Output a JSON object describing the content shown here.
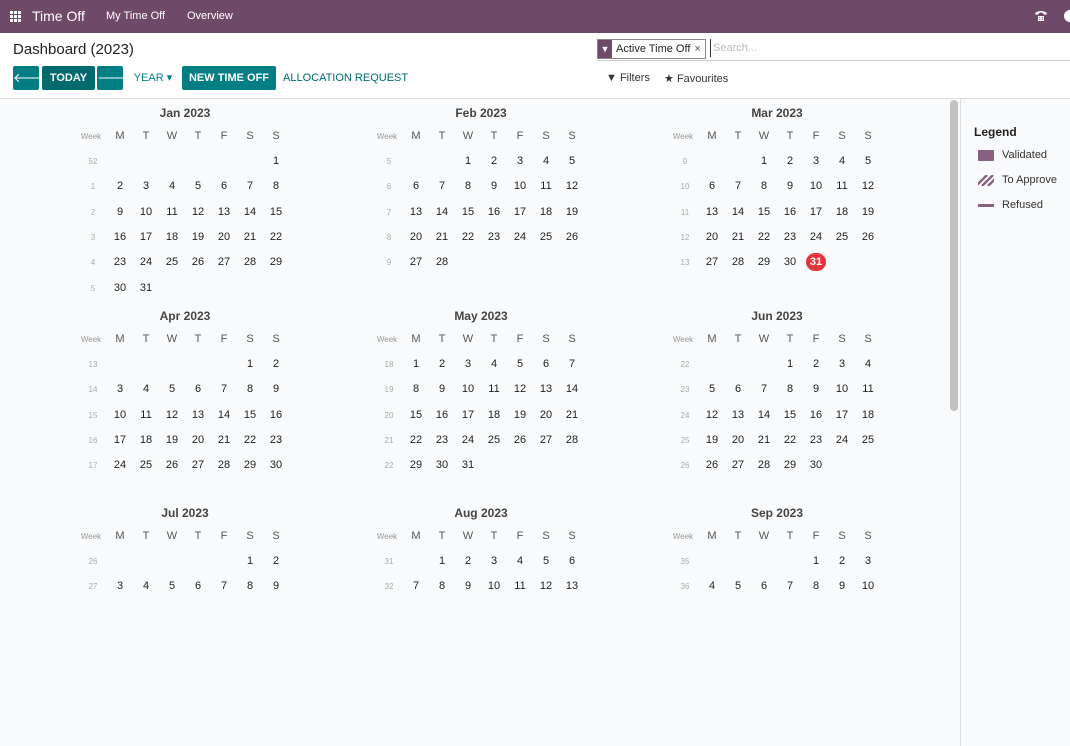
{
  "topbar": {
    "app_name": "Time Off",
    "nav": [
      "My Time Off",
      "Overview"
    ]
  },
  "control": {
    "title": "Dashboard (2023)",
    "prev_icon": "🡐",
    "next_icon": "🡒",
    "today_label": "TODAY",
    "scale_label": "YEAR ▾",
    "new_label": "NEW TIME OFF",
    "alloc_label": "ALLOCATION REQUEST",
    "facet_label": "Active Time Off",
    "search_placeholder": "Search...",
    "filters_label": "Filters",
    "favourites_label": "Favourites"
  },
  "calendar": {
    "day_headers": [
      "M",
      "T",
      "W",
      "T",
      "F",
      "S",
      "S"
    ],
    "week_label": "Week",
    "today": {
      "month": 2,
      "day": 31
    },
    "months": [
      {
        "name": "Jan 2023",
        "rows": [
          [
            52,
            "",
            "",
            "",
            "",
            "",
            "",
            1
          ],
          [
            1,
            2,
            3,
            4,
            5,
            6,
            7,
            8
          ],
          [
            2,
            9,
            10,
            11,
            12,
            13,
            14,
            15
          ],
          [
            3,
            16,
            17,
            18,
            19,
            20,
            21,
            22
          ],
          [
            4,
            23,
            24,
            25,
            26,
            27,
            28,
            29
          ],
          [
            5,
            30,
            31,
            "",
            "",
            "",
            "",
            ""
          ]
        ]
      },
      {
        "name": "Feb 2023",
        "rows": [
          [
            5,
            "",
            "",
            1,
            2,
            3,
            4,
            5
          ],
          [
            6,
            6,
            7,
            8,
            9,
            10,
            11,
            12
          ],
          [
            7,
            13,
            14,
            15,
            16,
            17,
            18,
            19
          ],
          [
            8,
            20,
            21,
            22,
            23,
            24,
            25,
            26
          ],
          [
            9,
            27,
            28,
            "",
            "",
            "",
            "",
            ""
          ]
        ]
      },
      {
        "name": "Mar 2023",
        "rows": [
          [
            9,
            "",
            "",
            1,
            2,
            3,
            4,
            5
          ],
          [
            10,
            6,
            7,
            8,
            9,
            10,
            11,
            12
          ],
          [
            11,
            13,
            14,
            15,
            16,
            17,
            18,
            19
          ],
          [
            12,
            20,
            21,
            22,
            23,
            24,
            25,
            26
          ],
          [
            13,
            27,
            28,
            29,
            30,
            31,
            "",
            ""
          ]
        ]
      },
      {
        "name": "Apr 2023",
        "rows": [
          [
            13,
            "",
            "",
            "",
            "",
            "",
            1,
            2
          ],
          [
            14,
            3,
            4,
            5,
            6,
            7,
            8,
            9
          ],
          [
            15,
            10,
            11,
            12,
            13,
            14,
            15,
            16
          ],
          [
            16,
            17,
            18,
            19,
            20,
            21,
            22,
            23
          ],
          [
            17,
            24,
            25,
            26,
            27,
            28,
            29,
            30
          ]
        ]
      },
      {
        "name": "May 2023",
        "rows": [
          [
            18,
            1,
            2,
            3,
            4,
            5,
            6,
            7
          ],
          [
            19,
            8,
            9,
            10,
            11,
            12,
            13,
            14
          ],
          [
            20,
            15,
            16,
            17,
            18,
            19,
            20,
            21
          ],
          [
            21,
            22,
            23,
            24,
            25,
            26,
            27,
            28
          ],
          [
            22,
            29,
            30,
            31,
            "",
            "",
            "",
            ""
          ]
        ]
      },
      {
        "name": "Jun 2023",
        "rows": [
          [
            22,
            "",
            "",
            "",
            1,
            2,
            3,
            4
          ],
          [
            23,
            5,
            6,
            7,
            8,
            9,
            10,
            11
          ],
          [
            24,
            12,
            13,
            14,
            15,
            16,
            17,
            18
          ],
          [
            25,
            19,
            20,
            21,
            22,
            23,
            24,
            25
          ],
          [
            26,
            26,
            27,
            28,
            29,
            30,
            "",
            ""
          ]
        ]
      },
      {
        "name": "Jul 2023",
        "rows": [
          [
            26,
            "",
            "",
            "",
            "",
            "",
            1,
            2
          ],
          [
            27,
            3,
            4,
            5,
            6,
            7,
            8,
            9
          ]
        ]
      },
      {
        "name": "Aug 2023",
        "rows": [
          [
            31,
            "",
            1,
            2,
            3,
            4,
            5,
            6
          ],
          [
            32,
            7,
            8,
            9,
            10,
            11,
            12,
            13
          ]
        ]
      },
      {
        "name": "Sep 2023",
        "rows": [
          [
            35,
            "",
            "",
            "",
            "",
            1,
            2,
            3
          ],
          [
            36,
            4,
            5,
            6,
            7,
            8,
            9,
            10
          ]
        ]
      }
    ]
  },
  "legend": {
    "title": "Legend",
    "items": [
      {
        "label": "Validated",
        "style": "solid",
        "color": "#876180"
      },
      {
        "label": "To Approve",
        "style": "hatched",
        "color": "#876180"
      },
      {
        "label": "Refused",
        "style": "line",
        "color": "#876180"
      }
    ]
  },
  "colors": {
    "brand": "#6f4a68",
    "primary": "#017e84",
    "today": "#e3353b"
  }
}
